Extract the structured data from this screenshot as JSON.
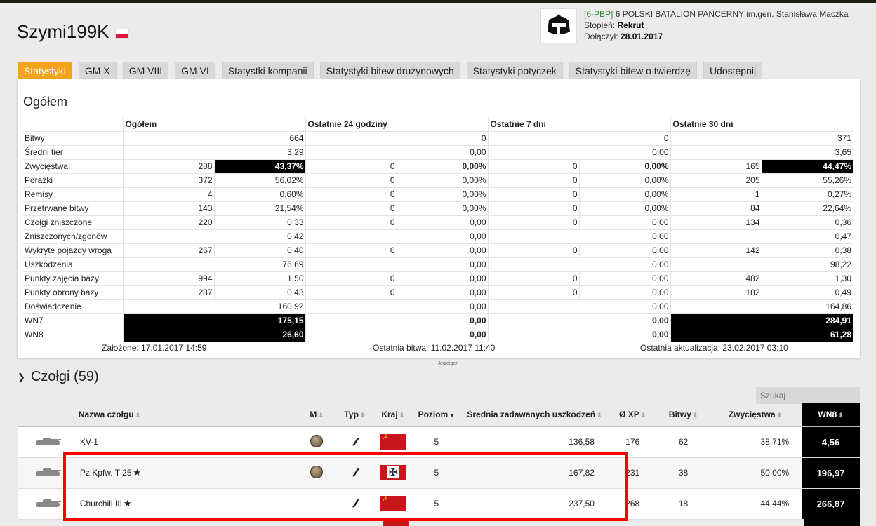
{
  "player": {
    "name": "Szymi199K"
  },
  "clan": {
    "tag": "[6-PBP]",
    "name": "6 POLSKI BATALION PANCERNY im.gen. Stanisława Maczka",
    "rank_label": "Stopień:",
    "rank": "Rekrut",
    "joined_label": "Dołączył:",
    "joined": "28.01.2017"
  },
  "tabs": [
    "Statystyki",
    "GM X",
    "GM VIII",
    "GM VI",
    "Statystki kompanii",
    "Statystyki bitew drużynowych",
    "Statystyki potyczek",
    "Statystyki bitew o twierdzę",
    "Udostępnij"
  ],
  "overview": {
    "title": "Ogółem",
    "headers": [
      "Ogółem",
      "Ostatnie 24 godziny",
      "Ostatnie 7 dni",
      "Ostatnie 30 dni"
    ],
    "rows": [
      {
        "label": "Bitwy",
        "kind": "single",
        "c": [
          "664",
          "0",
          "0",
          "371"
        ]
      },
      {
        "label": "Średni tier",
        "kind": "single",
        "c": [
          "3,29",
          "0,00",
          "0,00",
          "3,65"
        ]
      },
      {
        "label": "Zwycięstwa",
        "kind": "pair",
        "hl": true,
        "c": [
          [
            "288",
            "43,37%"
          ],
          [
            "0",
            "0,00%"
          ],
          [
            "0",
            "0,00%"
          ],
          [
            "165",
            "44,47%"
          ]
        ]
      },
      {
        "label": "Porażki",
        "kind": "pair",
        "c": [
          [
            "372",
            "56,02%"
          ],
          [
            "0",
            "0,00%"
          ],
          [
            "0",
            "0,00%"
          ],
          [
            "205",
            "55,26%"
          ]
        ]
      },
      {
        "label": "Remisy",
        "kind": "pair",
        "c": [
          [
            "4",
            "0,60%"
          ],
          [
            "0",
            "0,00%"
          ],
          [
            "0",
            "0,00%"
          ],
          [
            "1",
            "0,27%"
          ]
        ]
      },
      {
        "label": "Przetrwane bitwy",
        "kind": "pair",
        "c": [
          [
            "143",
            "21,54%"
          ],
          [
            "0",
            "0,00%"
          ],
          [
            "0",
            "0,00%"
          ],
          [
            "84",
            "22,64%"
          ]
        ]
      },
      {
        "label": "Czołgi zniszczone",
        "kind": "pair",
        "c": [
          [
            "220",
            "0,33"
          ],
          [
            "0",
            "0,00"
          ],
          [
            "0",
            "0,00"
          ],
          [
            "134",
            "0,36"
          ]
        ]
      },
      {
        "label": "Zniszczonych/zgonów",
        "kind": "single",
        "c": [
          "0,42",
          "0,00",
          "0,00",
          "0,47"
        ]
      },
      {
        "label": "Wykryte pojazdy wroga",
        "kind": "pair",
        "c": [
          [
            "267",
            "0,40"
          ],
          [
            "0",
            "0,00"
          ],
          [
            "0",
            "0,00"
          ],
          [
            "142",
            "0,38"
          ]
        ]
      },
      {
        "label": "Uszkodzenia",
        "kind": "single",
        "c": [
          "76,69",
          "0,00",
          "0,00",
          "98,22"
        ]
      },
      {
        "label": "Punkty zajęcia bazy",
        "kind": "pair",
        "c": [
          [
            "994",
            "1,50"
          ],
          [
            "0",
            "0,00"
          ],
          [
            "0",
            "0,00"
          ],
          [
            "482",
            "1,30"
          ]
        ]
      },
      {
        "label": "Punkty obrony bazy",
        "kind": "pair",
        "c": [
          [
            "287",
            "0,43"
          ],
          [
            "0",
            "0,00"
          ],
          [
            "0",
            "0,00"
          ],
          [
            "182",
            "0,49"
          ]
        ]
      },
      {
        "label": "Doświadczenie",
        "kind": "single",
        "c": [
          "160,92",
          "0,00",
          "0,00",
          "164,86"
        ]
      },
      {
        "label": "WN7",
        "kind": "wn",
        "c": [
          "175,15",
          "0,00",
          "0,00",
          "284,91"
        ]
      },
      {
        "label": "WN8",
        "kind": "wn",
        "c": [
          "26,60",
          "0,00",
          "0,00",
          "61,28"
        ]
      }
    ],
    "created": "Założone: 17.01.2017 14:59",
    "last_battle": "Ostatnia bitwa: 11.02.2017 11:40",
    "last_update": "Ostatnia aktualizacja: 23.02.2017 03:10"
  },
  "ads_label": "Anzeigen",
  "tanks_section": {
    "title": "Czołgi (59)",
    "search_placeholder": "Szukaj",
    "columns": [
      "Nazwa czołgu",
      "M",
      "Typ",
      "Kraj",
      "Poziom",
      "Średnia zadawanych uszkodzeń",
      "Ø XP",
      "Bitwy",
      "Zwycięstwa",
      "WN8"
    ],
    "rows": [
      {
        "name": "KV-1",
        "star": false,
        "mastery": true,
        "nation": "ussr",
        "tier": "5",
        "avg_dmg": "136,58",
        "xp": "176",
        "battles": "62",
        "winrate": "38,71%",
        "wn8": "4,56"
      },
      {
        "name": "Pz.Kpfw. T 25",
        "star": true,
        "mastery": true,
        "nation": "germany",
        "tier": "5",
        "avg_dmg": "167,82",
        "xp": "231",
        "battles": "38",
        "winrate": "50,00%",
        "wn8": "196,97"
      },
      {
        "name": "Churchill III",
        "star": true,
        "mastery": false,
        "nation": "ussr",
        "tier": "5",
        "avg_dmg": "237,50",
        "xp": "268",
        "battles": "18",
        "winrate": "44,44%",
        "wn8": "266,87"
      }
    ]
  },
  "icons": {
    "flag": "poland-flag-icon",
    "clan_logo": "clan-emblem-icon",
    "sort": "sort-arrows-icon",
    "mastery": "mastery-badge-icon",
    "type": "medium-tank-type-icon",
    "star": "star-icon",
    "chevron": "chevron-down-icon"
  },
  "colors": {
    "accent": "#f4a31b",
    "clan_tag": "#2a8c2a",
    "highlight": "#ff0000",
    "wn_bg": "#000000"
  }
}
